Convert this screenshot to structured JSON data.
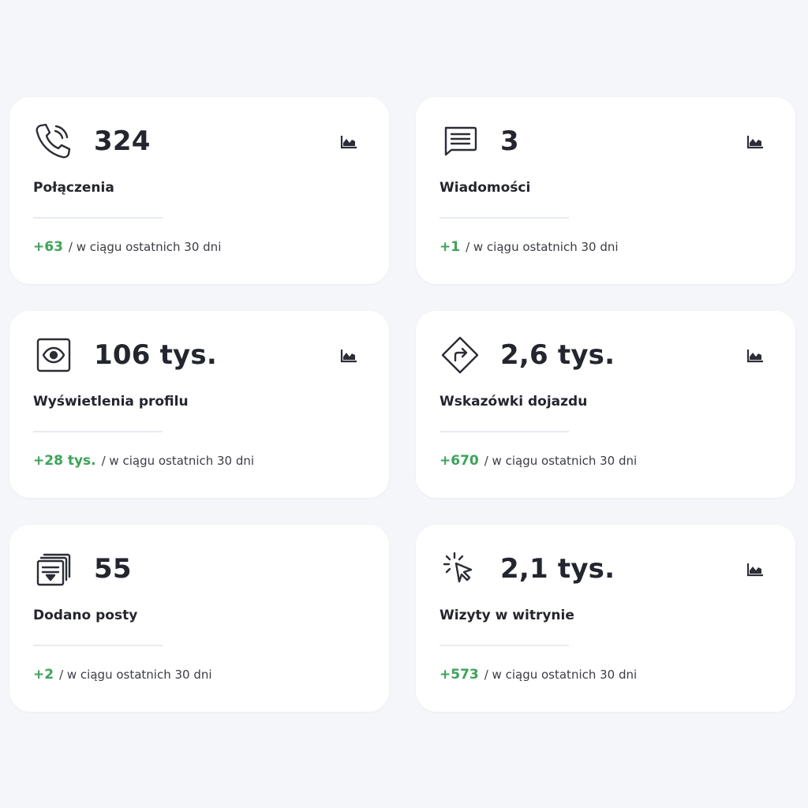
{
  "colors": {
    "positive": "#34a853",
    "text": "#23262f",
    "card_bg": "#ffffff",
    "page_bg": "#f4f6fa"
  },
  "cards": [
    {
      "icon": "phone-call-icon",
      "value": "324",
      "label": "Połączenia",
      "delta": "+63",
      "period": "/ w ciągu ostatnich 30 dni"
    },
    {
      "icon": "message-icon",
      "value": "3",
      "label": "Wiadomości",
      "delta": "+1",
      "period": "/ w ciągu ostatnich 30 dni"
    },
    {
      "icon": "eye-icon",
      "value": "106 tys.",
      "label": "Wyświetlenia profilu",
      "delta": "+28 tys.",
      "period": "/ w ciągu ostatnich 30 dni"
    },
    {
      "icon": "directions-icon",
      "value": "2,6 tys.",
      "label": "Wskazówki dojazdu",
      "delta": "+670",
      "period": "/ w ciągu ostatnich 30 dni"
    },
    {
      "icon": "posts-icon",
      "value": "55",
      "label": "Dodano posty",
      "delta": "+2",
      "period": "/ w ciągu ostatnich 30 dni"
    },
    {
      "icon": "click-icon",
      "value": "2,1 tys.",
      "label": "Wizyty w witrynie",
      "delta": "+573",
      "period": "/ w ciągu ostatnich 30 dni"
    }
  ]
}
